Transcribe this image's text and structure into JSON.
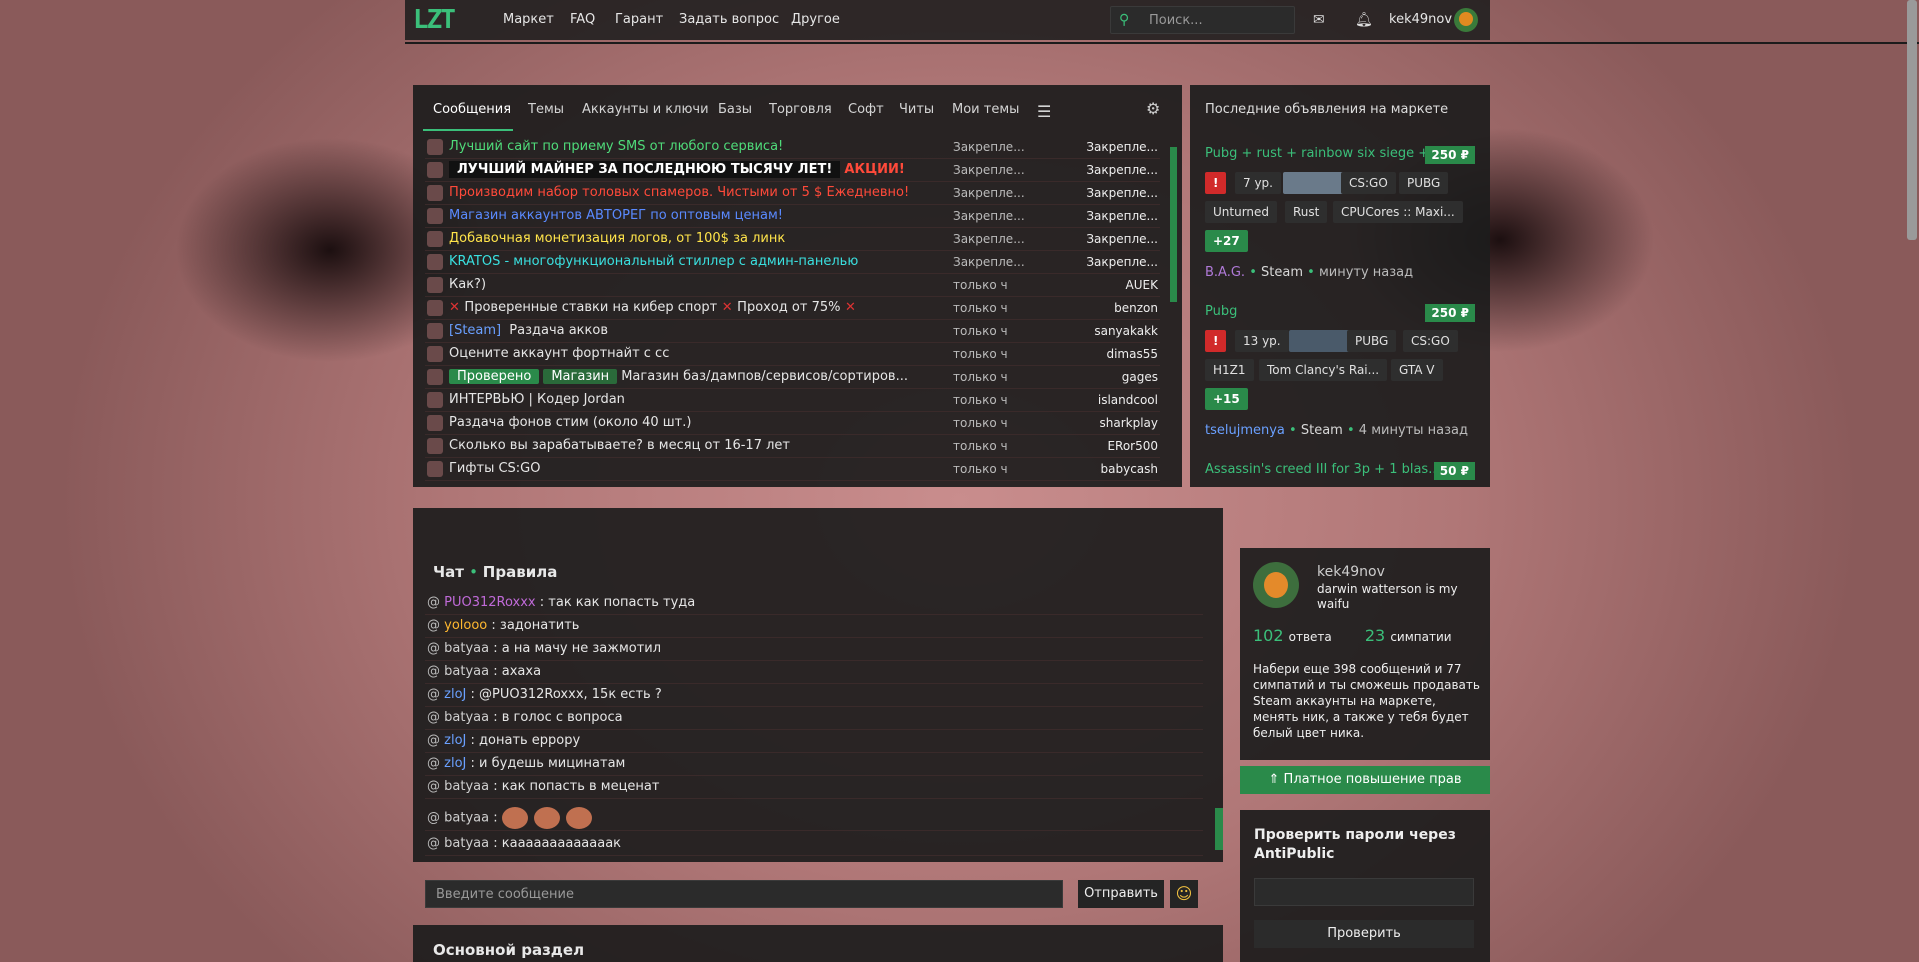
{
  "header": {
    "logo": "LZT",
    "nav": [
      "Маркет",
      "FAQ",
      "Гарант",
      "Задать вопрос",
      "Другое"
    ],
    "search_placeholder": "Поиск...",
    "username": "kek49nov"
  },
  "threads": {
    "tabs": [
      "Сообщения",
      "Темы",
      "Аккаунты и ключи",
      "Базы",
      "Торговля",
      "Софт",
      "Читы",
      "Мои темы"
    ],
    "rows": [
      {
        "title": "Лучший сайт по приему SMS от любого сервиса!",
        "status": "Закрепле...",
        "author": "Закрепле...",
        "color": "#4fdc7a"
      },
      {
        "title": "ЛУЧШИЙ МАЙНЕР ЗА ПОСЛЕДНЮЮ ТЫСЯЧУ ЛЕТ!",
        "extra": "АКЦИИ!",
        "status": "Закрепле...",
        "author": "Закрепле...",
        "color": "#ffffff"
      },
      {
        "title": "Производим набор толовых спамеров. Чистыми от 5 $ Ежедневно!",
        "status": "Закрепле...",
        "author": "Закрепле...",
        "color": "#ff4a3a"
      },
      {
        "title": "Магазин аккаунтов АВТОРЕГ по оптовым ценам!",
        "status": "Закрепле...",
        "author": "Закрепле...",
        "color": "#5a8aff"
      },
      {
        "title": "Добавочная монетизация логов, от 100$ за линк",
        "status": "Закрепле...",
        "author": "Закрепле...",
        "color": "#ffe44a"
      },
      {
        "title": "KRATOS - многофункциональный стиллер с админ-панелью",
        "status": "Закрепле...",
        "author": "Закрепле...",
        "color": "#3ae0e0"
      },
      {
        "title": "Как?)",
        "status": "только ч",
        "author": "AUEK",
        "color": "#e6e6e6"
      },
      {
        "title": "Проверенные ставки на кибер спорт",
        "extra": "Проход от 75%",
        "status": "только ч",
        "author": "benzon",
        "color": "#e6e6e6"
      },
      {
        "prefix": "[Steam]",
        "title": "Раздача акков",
        "status": "только ч",
        "author": "sanyakakk",
        "color": "#e6e6e6"
      },
      {
        "title": "Оцените аккаунт фортнайт с сс",
        "status": "только ч",
        "author": "dimas55",
        "color": "#e6e6e6"
      },
      {
        "tags": [
          "Проверено",
          "Магазин"
        ],
        "title": "Магазин баз/дампов/сервисов/сортиров...",
        "status": "только ч",
        "author": "gages",
        "color": "#e6e6e6"
      },
      {
        "title": "ИНТЕРВЬЮ | Кодер Jordan",
        "status": "только ч",
        "author": "islandcool",
        "color": "#e6e6e6"
      },
      {
        "title": "Раздача фонов стим (около 40 шт.)",
        "status": "только ч",
        "author": "sharkplay",
        "color": "#e6e6e6"
      },
      {
        "title": "Сколько вы зарабатываете? в месяц от 16-17 лет",
        "status": "только ч",
        "author": "ERor500",
        "color": "#e6e6e6"
      },
      {
        "title": "Гифты CS:GO",
        "status": "только ч",
        "author": "babycash",
        "color": "#e6e6e6"
      }
    ]
  },
  "market": {
    "title": "Последние объявления на маркете",
    "items": [
      {
        "name": "Pubg + rust + rainbow six siege + ...",
        "price": "250 ₽",
        "level": "7 ур.",
        "games1": [
          "CS:GO",
          "PUBG"
        ],
        "games2": [
          "Unturned",
          "Rust",
          "CPUCores :: Maxi..."
        ],
        "more": "+27",
        "seller": "B.A.G.",
        "platform": "Steam",
        "time": "минуту назад",
        "seller_color": "#b07ad8"
      },
      {
        "name": "Pubg",
        "price": "250 ₽",
        "level": "13 ур.",
        "games1": [
          "PUBG",
          "CS:GO"
        ],
        "games2": [
          "H1Z1",
          "Tom Clancy's Rai...",
          "GTA V"
        ],
        "more": "+15",
        "seller": "tselujmenya",
        "platform": "Steam",
        "time": "4 минуты назад",
        "seller_color": "#6aa0ff"
      },
      {
        "name": "Assassin's creed III for 3p + 1 blas...",
        "price": "50 ₽"
      }
    ]
  },
  "chat": {
    "title": "Чат",
    "rules": "Правила",
    "messages": [
      {
        "user": "PUO312Roxxx",
        "text": "так как попасть туда",
        "color": "#c06ad8"
      },
      {
        "user": "yolooo",
        "text": "задонатить",
        "color": "#ffb830"
      },
      {
        "user": "batyaa",
        "text": "а на мачу не зажмотил",
        "color": "#cfcfcf"
      },
      {
        "user": "batyaa",
        "text": "ахаха",
        "color": "#cfcfcf"
      },
      {
        "user": "zloJ",
        "text": "@PUO312Roxxx, 15к есть ?",
        "color": "#6aa0ff"
      },
      {
        "user": "batyaa",
        "text": "в голос с вопроса",
        "color": "#cfcfcf"
      },
      {
        "user": "zloJ",
        "text": "донать ерроpy",
        "color": "#6aa0ff"
      },
      {
        "user": "zloJ",
        "text": "и будешь мицинатам",
        "color": "#6aa0ff"
      },
      {
        "user": "batyaa",
        "text": "как попасть в меценат",
        "color": "#cfcfcf"
      },
      {
        "user": "batyaa",
        "text": "",
        "emoji": true,
        "color": "#cfcfcf"
      },
      {
        "user": "batyaa",
        "text": "кааааааааааааак",
        "color": "#cfcfcf"
      }
    ],
    "input_placeholder": "Введите сообщение",
    "send_label": "Отправить"
  },
  "main_section": "Основной раздел",
  "profile": {
    "name": "kek49nov",
    "status": "darwin watterson is my waifu",
    "replies_count": "102",
    "replies_label": "ответа",
    "likes_count": "23",
    "likes_label": "симпатии",
    "info": "Набери еще 398 сообщений и 77 симпатий и ты сможешь продавать Steam аккаунты на маркете, менять ник, а также у тебя будет белый цвет ника.",
    "upgrade_label": "⇑ Платное повышение прав"
  },
  "antipublic": {
    "title": "Проверить пароли через AntiPublic",
    "button_label": "Проверить"
  },
  "colors": {
    "accent": "#3bbf7a",
    "panel": "#1c1c1c",
    "warn": "#d12a2a"
  }
}
